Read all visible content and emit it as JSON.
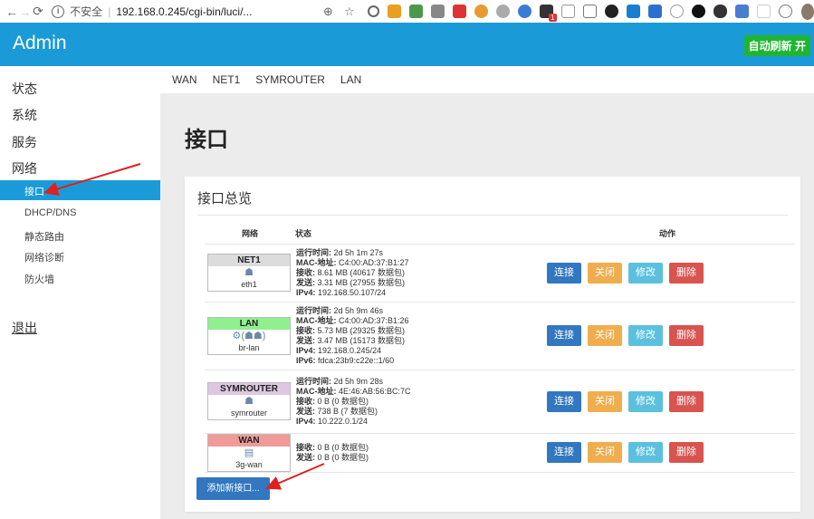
{
  "browser": {
    "insecure_label": "不安全",
    "url": "192.168.0.245/cgi-bin/luci/..."
  },
  "header": {
    "brand": "Admin",
    "auto_refresh": "自动刷新 开",
    "colors": {
      "bar": "#1a9bd7",
      "refresh": "#1fb533"
    }
  },
  "sidebar": {
    "items": [
      "状态",
      "系统",
      "服务",
      "网络"
    ],
    "sub_items": [
      "接口",
      "DHCP/DNS",
      "静态路由",
      "网络诊断",
      "防火墙"
    ],
    "active": "接口",
    "logout": "退出"
  },
  "tabs": [
    "WAN",
    "NET1",
    "SYMROUTER",
    "LAN"
  ],
  "page": {
    "title": "接口",
    "card_title": "接口总览",
    "add_button": "添加新接口..."
  },
  "table": {
    "headers": {
      "network": "网络",
      "status": "状态",
      "actions": "动作"
    },
    "button_labels": {
      "connect": "连接",
      "stop": "关闭",
      "edit": "修改",
      "delete": "删除"
    },
    "rows": [
      {
        "name": "NET1",
        "device": "eth1",
        "color": "#dcdcdc",
        "status": [
          [
            "运行时间:",
            " 2d 5h 1m 27s"
          ],
          [
            "MAC-地址:",
            " C4:00:AD:37:B1:27"
          ],
          [
            "接收:",
            " 8.61 MB (40617 数据包)"
          ],
          [
            "发送:",
            " 3.31 MB (27955 数据包)"
          ],
          [
            "IPv4:",
            " 192.168.50.107/24"
          ]
        ]
      },
      {
        "name": "LAN",
        "device": "br-lan",
        "color": "#90f090",
        "status": [
          [
            "运行时间:",
            " 2d 5h 9m 46s"
          ],
          [
            "MAC-地址:",
            " C4:00:AD:37:B1:26"
          ],
          [
            "接收:",
            " 5.73 MB (29325 数据包)"
          ],
          [
            "发送:",
            " 3.47 MB (15173 数据包)"
          ],
          [
            "IPv4:",
            " 192.168.0.245/24"
          ],
          [
            "IPv6:",
            " fdca:23b9:c22e::1/60"
          ]
        ]
      },
      {
        "name": "SYMROUTER",
        "device": "symrouter",
        "color": "#dcc8e0",
        "status": [
          [
            "运行时间:",
            " 2d 5h 9m 28s"
          ],
          [
            "MAC-地址:",
            " 4E:46:AB:56:BC:7C"
          ],
          [
            "接收:",
            " 0 B (0 数据包)"
          ],
          [
            "发送:",
            " 738 B (7 数据包)"
          ],
          [
            "IPv4:",
            " 10.222.0.1/24"
          ]
        ]
      },
      {
        "name": "WAN",
        "device": "3g-wan",
        "color": "#f09a9a",
        "status": [
          [
            "接收:",
            " 0 B (0 数据包)"
          ],
          [
            "发送:",
            " 0 B (0 数据包)"
          ]
        ]
      }
    ]
  }
}
